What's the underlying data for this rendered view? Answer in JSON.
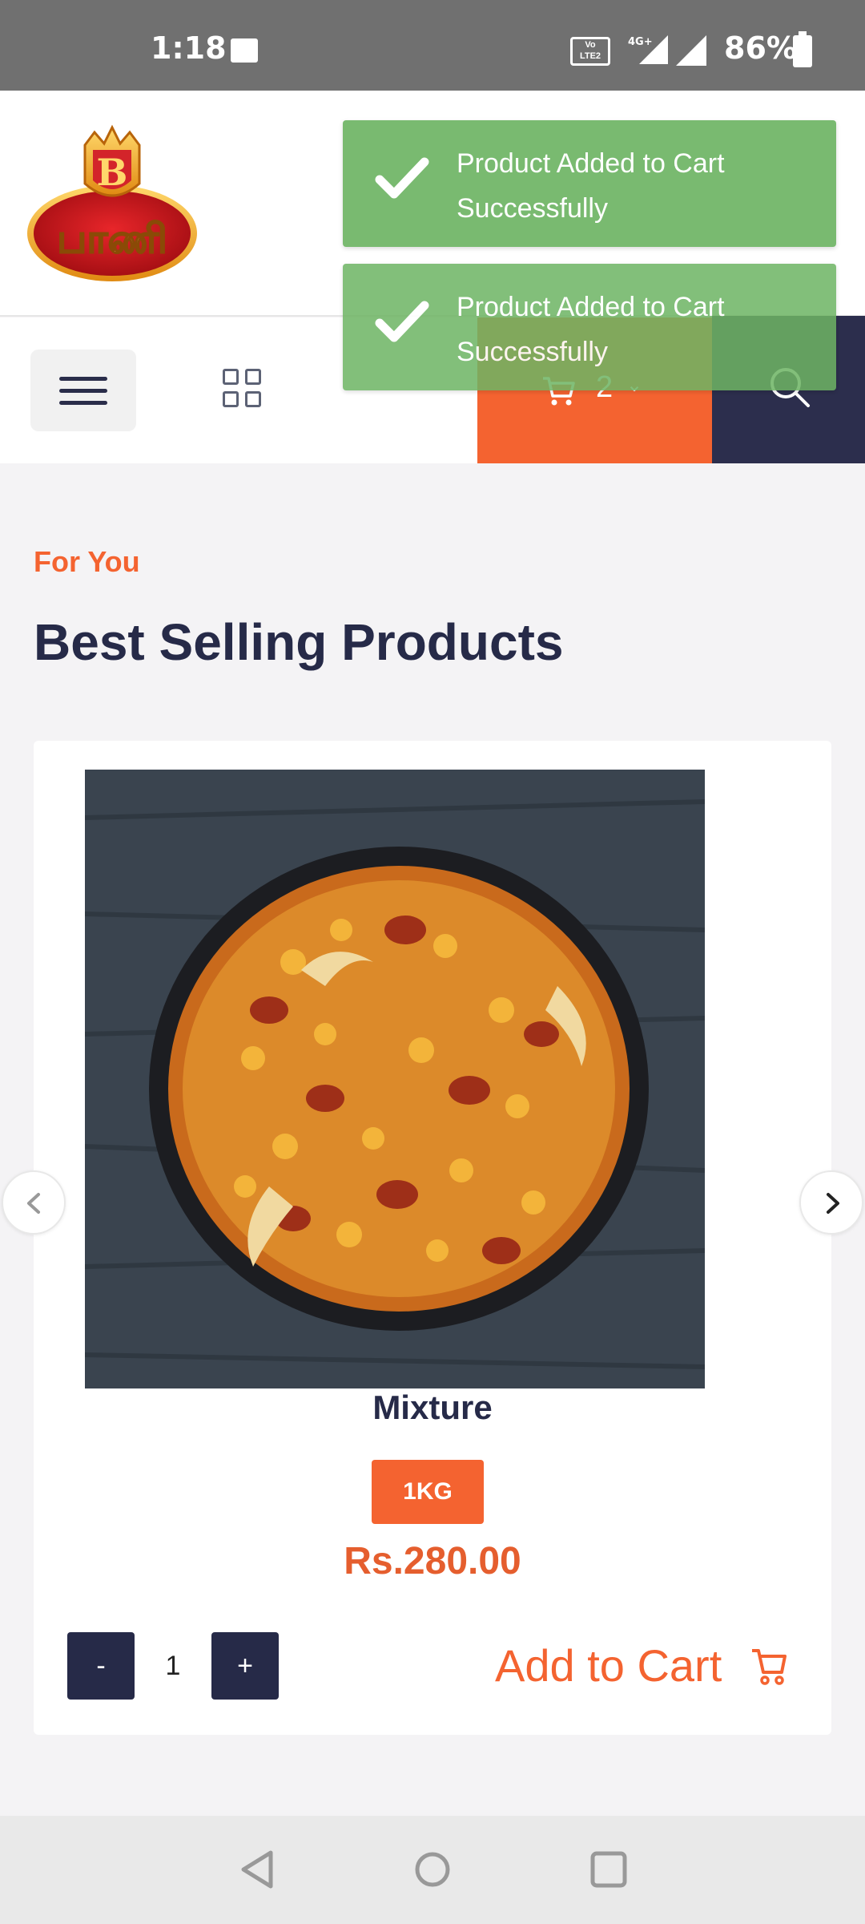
{
  "status_bar": {
    "time": "1:18",
    "battery": "86%",
    "network": "4G+",
    "volte": "Vo LTE 2",
    "icons": [
      "image-icon",
      "volte-icon",
      "signal-icon",
      "signal-icon",
      "battery-icon"
    ]
  },
  "header": {
    "logo_text": "பாணி",
    "logo_letter": "B"
  },
  "nav": {
    "cart_count": "2",
    "icons": [
      "menu-icon",
      "grid-icon",
      "cart-icon",
      "search-icon"
    ]
  },
  "toasts": [
    {
      "message": "Product Added to Cart Successfully"
    },
    {
      "message": "Product Added to Cart Successfully"
    }
  ],
  "section": {
    "eyebrow": "For You",
    "title": "Best Selling Products"
  },
  "product": {
    "name": "Mixture",
    "weight": "1KG",
    "price": "Rs.280.00",
    "quantity": "1",
    "minus_label": "-",
    "plus_label": "+",
    "add_to_cart": "Add to Cart"
  },
  "colors": {
    "accent": "#f46330",
    "navy": "#262a48",
    "toast": "#6eb464",
    "background": "#f4f3f5"
  }
}
